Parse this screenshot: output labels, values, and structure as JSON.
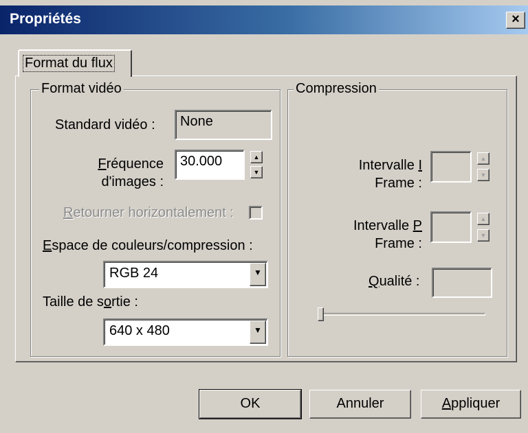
{
  "window": {
    "title": "Propriétés",
    "close_glyph": "×"
  },
  "tabs": [
    {
      "label": "Format du flux",
      "selected": true
    }
  ],
  "format_video": {
    "legend": "Format vidéo",
    "standard_label": "Standard vidéo :",
    "standard_value": "None",
    "freq_label_line1_pre": "",
    "freq_label_line1_access": "F",
    "freq_label_line1_post": "réquence",
    "freq_label_line2": "d'images :",
    "freq_value": "30.000",
    "flip_label_access": "R",
    "flip_label_post": "etourner horizontalement :",
    "flip_checked": false,
    "colorspace_label_access": "E",
    "colorspace_label_post": "space de couleurs/compression :",
    "colorspace_value": "RGB 24",
    "output_label_pre": "Taille de s",
    "output_label_access": "o",
    "output_label_post": "rtie :",
    "output_value": "640 x 480"
  },
  "compression": {
    "legend": "Compression",
    "iframe_label_pre": "Intervalle ",
    "iframe_label_access": "I",
    "iframe_label_line2": "Frame :",
    "iframe_value": "",
    "pframe_label_pre": "Intervalle ",
    "pframe_label_access": "P",
    "pframe_label_line2": "Frame :",
    "pframe_value": "",
    "quality_label_access": "Q",
    "quality_label_post": "ualité :",
    "quality_value": "",
    "quality_slider_level": 0
  },
  "buttons": {
    "ok": "OK",
    "cancel": "Annuler",
    "apply_access": "A",
    "apply_post": "ppliquer"
  },
  "icons": {
    "spin_up": "▲",
    "spin_down": "▼",
    "dropdown": "▼"
  },
  "colors": {
    "titlebar_start": "#0a246a",
    "titlebar_end": "#a6caf0",
    "face": "#d4d0c8"
  }
}
